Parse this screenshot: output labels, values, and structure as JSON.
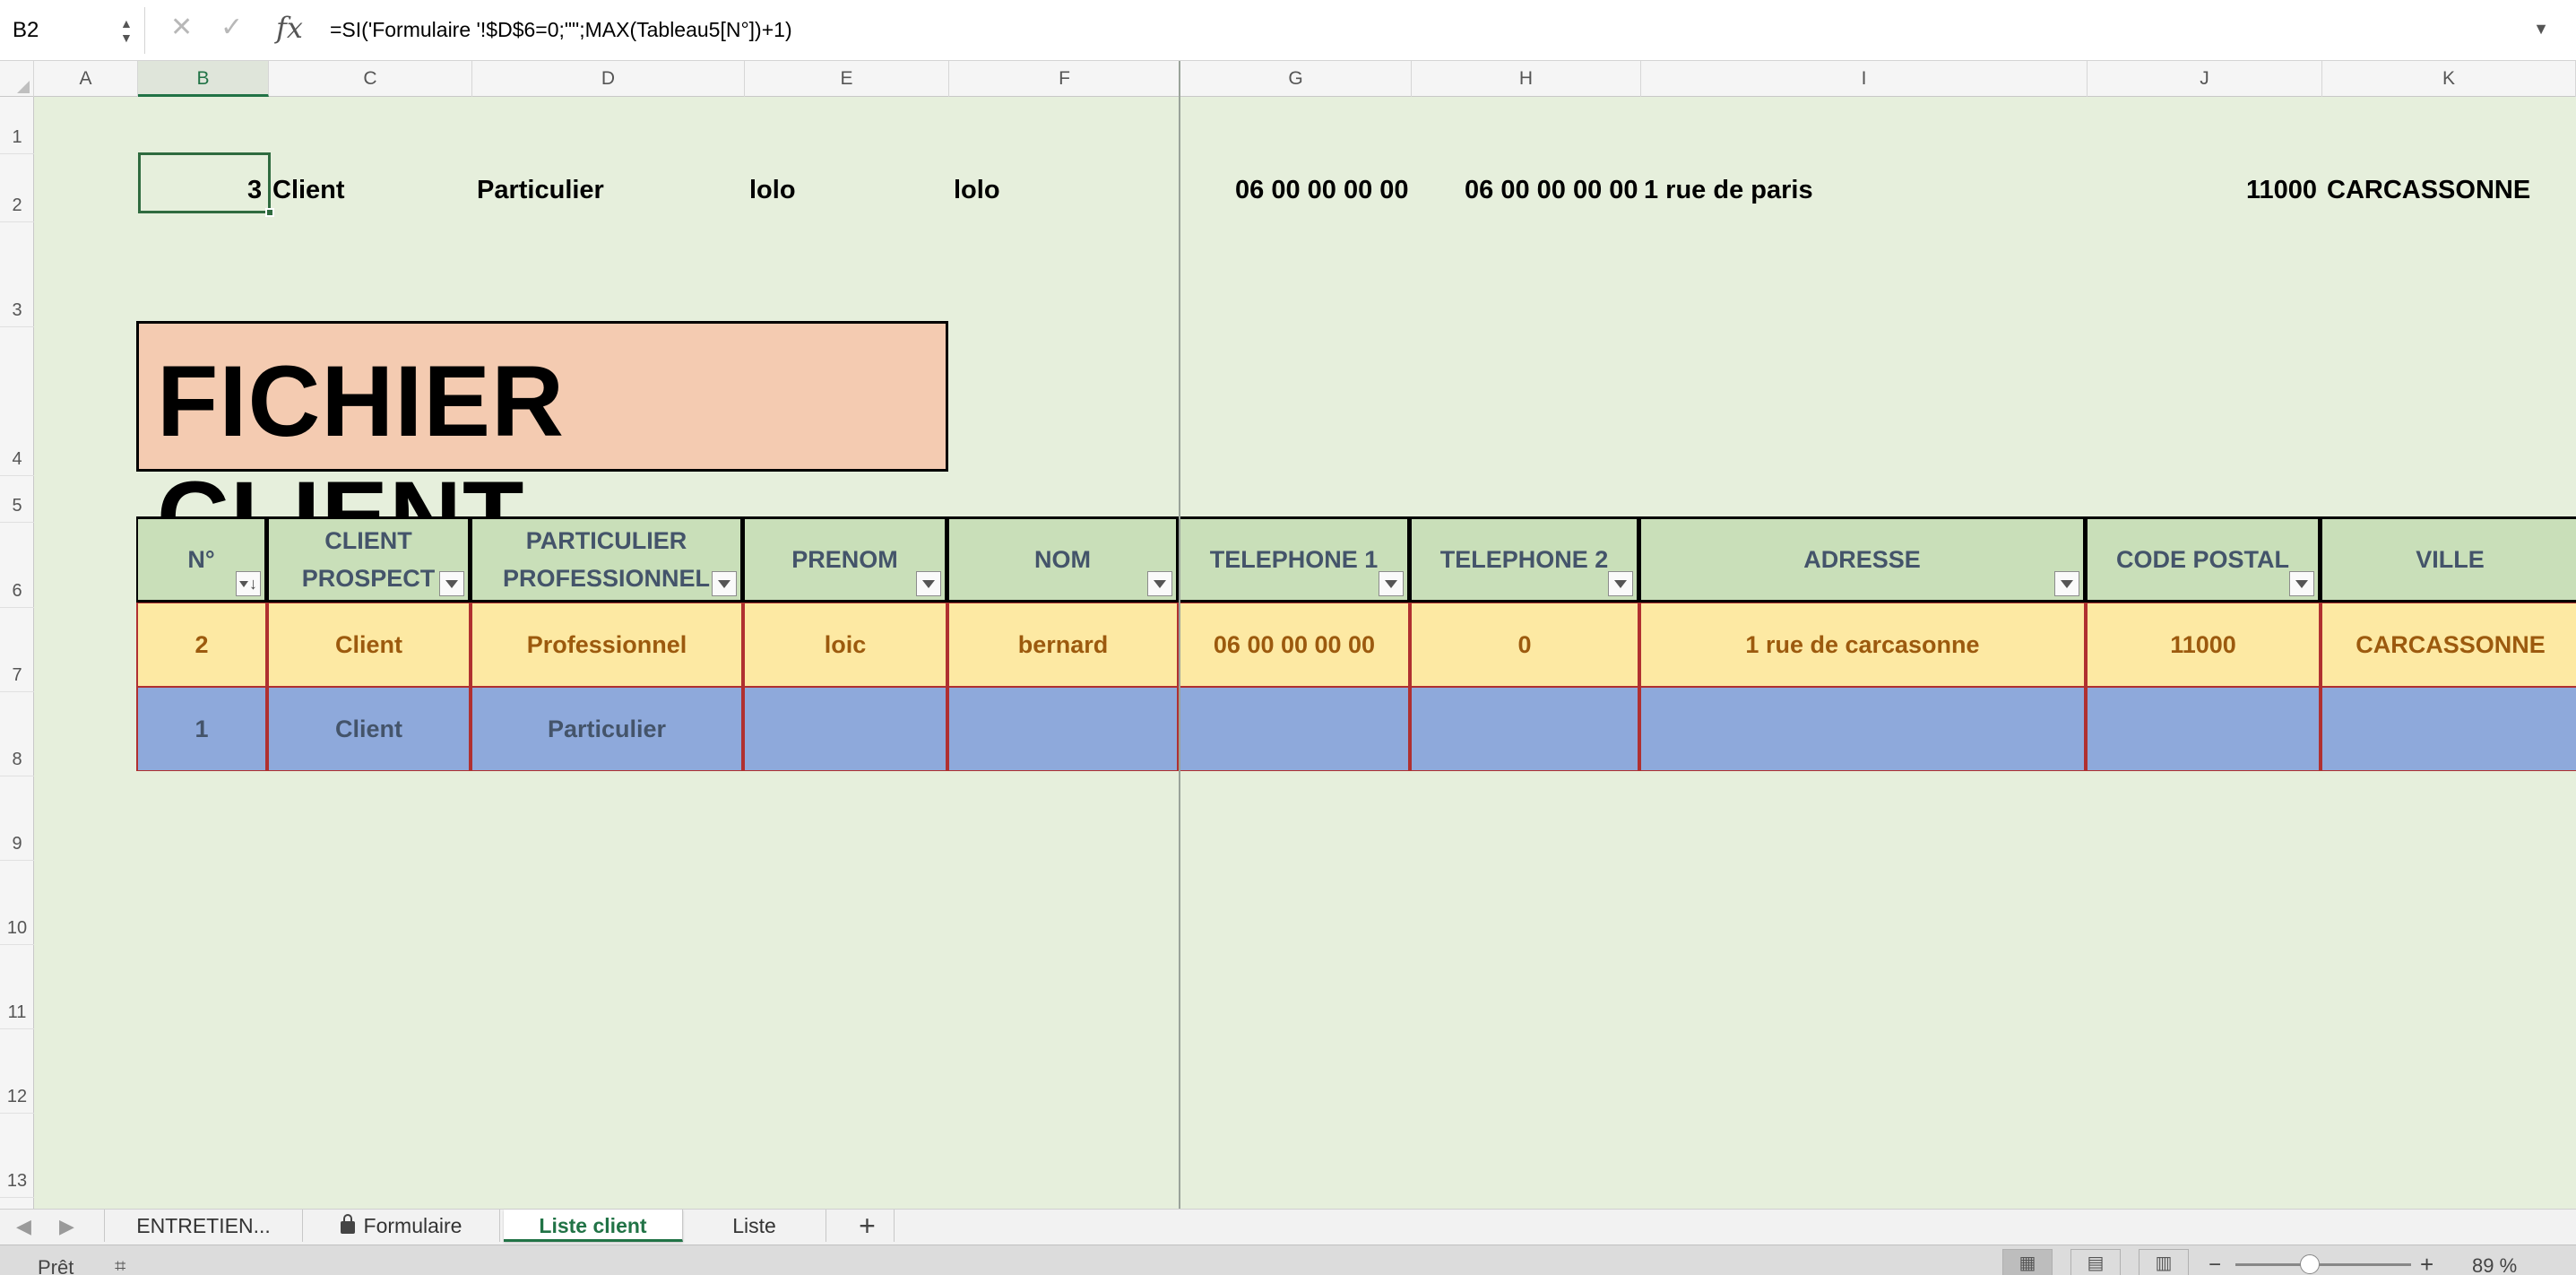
{
  "formula_bar": {
    "name_box": "B2",
    "formula": "=SI('Formulaire '!$D$6=0;\"\";MAX(Tableau5[N°])+1)"
  },
  "columns": [
    "A",
    "B",
    "C",
    "D",
    "E",
    "F",
    "G",
    "H",
    "I",
    "J",
    "K"
  ],
  "rows": [
    "1",
    "2",
    "3",
    "4",
    "5",
    "6",
    "7",
    "8",
    "9",
    "10",
    "11",
    "12",
    "13"
  ],
  "row2": {
    "b": "3",
    "c": "Client",
    "d": "Particulier",
    "e": "lolo",
    "f": "lolo",
    "g": "06 00 00 00 00",
    "h": "06 00 00 00 00",
    "i": "1 rue de paris",
    "j": "11000",
    "k": "CARCASSONNE"
  },
  "title": "FICHIER CLIENT",
  "table": {
    "headers": [
      {
        "label": "N°"
      },
      {
        "label": "CLIENT PROSPECT"
      },
      {
        "label": "PARTICULIER PROFESSIONNEL"
      },
      {
        "label": "PRENOM"
      },
      {
        "label": "NOM"
      },
      {
        "label": "TELEPHONE 1"
      },
      {
        "label": "TELEPHONE 2"
      },
      {
        "label": "ADRESSE"
      },
      {
        "label": "CODE POSTAL"
      },
      {
        "label": "VILLE"
      }
    ],
    "rows": [
      [
        "2",
        "Client",
        "Professionnel",
        "loic",
        "bernard",
        "06 00 00 00 00",
        "0",
        "1 rue de carcasonne",
        "11000",
        "CARCASSONNE"
      ],
      [
        "1",
        "Client",
        "Particulier",
        "",
        "",
        "",
        "",
        "",
        "",
        ""
      ]
    ]
  },
  "sheet_tabs": [
    {
      "label": "ENTRETIEN...",
      "locked": false,
      "active": false
    },
    {
      "label": "Formulaire",
      "locked": true,
      "active": false
    },
    {
      "label": "Liste client",
      "locked": false,
      "active": true
    },
    {
      "label": "Liste",
      "locked": false,
      "active": false
    }
  ],
  "status": {
    "text": "Prêt",
    "zoom": "89 %"
  },
  "colors": {
    "sheet_bg": "#e6efdc",
    "header_fill": "#c9dfb9",
    "header_text": "#44546a",
    "row_yellow": "#fde9a3",
    "row_yellow_text": "#9c5a0e",
    "row_blue": "#8ea9db",
    "title_fill": "#f4cbb1",
    "accent": "#217346"
  }
}
